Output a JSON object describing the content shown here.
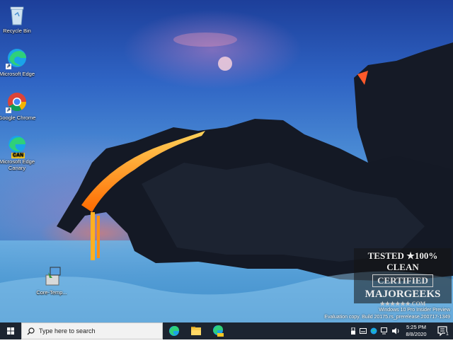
{
  "desktop": {
    "icons": [
      {
        "label": "Recycle Bin",
        "icon": "recycle-bin-icon"
      },
      {
        "label": "Microsoft Edge",
        "icon": "edge-icon"
      },
      {
        "label": "Google Chrome",
        "icon": "chrome-icon"
      },
      {
        "label": "Microsoft Edge Canary",
        "icon": "edge-canary-icon",
        "badge": "CAN"
      },
      {
        "label": "Core-Temp...",
        "icon": "installer-icon"
      }
    ]
  },
  "watermark": {
    "line1": "Windows 10 Pro Insider Preview",
    "line2": "Evaluation copy. Build 20175.rs_prerelease.200717-1349"
  },
  "majorgeeks_stamp": {
    "line1": "TESTED ★100% CLEAN",
    "line2": "CERTIFIED",
    "line3": "MAJORGEEKS",
    "line4": "★★★★★★.COM"
  },
  "taskbar": {
    "search_placeholder": "Type here to search",
    "pinned": [
      "edge-icon",
      "file-explorer-icon",
      "edge-canary-icon"
    ],
    "tray_icons": [
      "usb-icon",
      "keyboard-icon",
      "security-icon",
      "network-icon",
      "volume-icon"
    ],
    "time": "5:25 PM",
    "date": "8/8/2020",
    "notification_count": "1"
  },
  "colors": {
    "taskbar_bg": "#1c2430",
    "search_bg": "#f2f2f2",
    "accent": "#0078d7",
    "lava": "#ff8c1a"
  }
}
